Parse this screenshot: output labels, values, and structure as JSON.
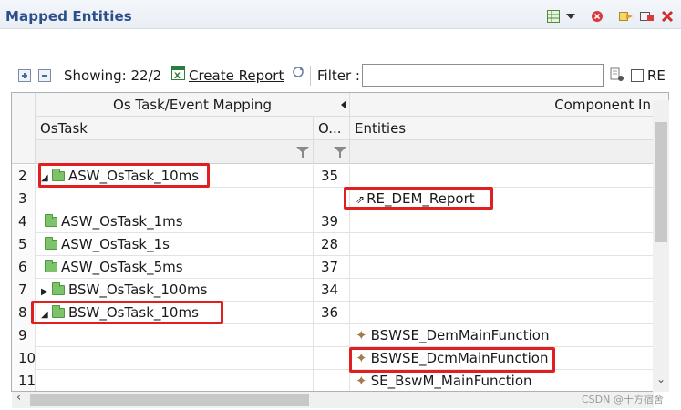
{
  "title": "Mapped Entities",
  "toolbar": {
    "showing": "Showing: 22/2",
    "create_report": "Create Report",
    "filter_label": "Filter :",
    "filter_value": "",
    "re_label": "RE"
  },
  "columns": {
    "group_left": "Os Task/Event Mapping",
    "group_right": "Component In",
    "ostask": "OsTask",
    "o": "O...",
    "entities": "Entities"
  },
  "rows": [
    {
      "num": "2",
      "task": "ASW_OsTask_10ms",
      "o": "35",
      "entity": ""
    },
    {
      "num": "3",
      "task": "",
      "o": "",
      "entity": "RE_DEM_Report"
    },
    {
      "num": "4",
      "task": "ASW_OsTask_1ms",
      "o": "39",
      "entity": ""
    },
    {
      "num": "5",
      "task": "ASW_OsTask_1s",
      "o": "28",
      "entity": ""
    },
    {
      "num": "6",
      "task": "ASW_OsTask_5ms",
      "o": "37",
      "entity": ""
    },
    {
      "num": "7",
      "task": "BSW_OsTask_100ms",
      "o": "34",
      "entity": ""
    },
    {
      "num": "8",
      "task": "BSW_OsTask_10ms",
      "o": "36",
      "entity": ""
    },
    {
      "num": "9",
      "task": "",
      "o": "",
      "entity": "BSWSE_DemMainFunction"
    },
    {
      "num": "10",
      "task": "",
      "o": "",
      "entity": "BSWSE_DcmMainFunction"
    },
    {
      "num": "11",
      "task": "",
      "o": "",
      "entity": "SE_BswM_MainFunction"
    }
  ],
  "watermark": "CSDN @十方宿舍",
  "colors": {
    "title": "#2b4e8c",
    "highlight": "#e02020",
    "folder": "#7cc36a"
  }
}
